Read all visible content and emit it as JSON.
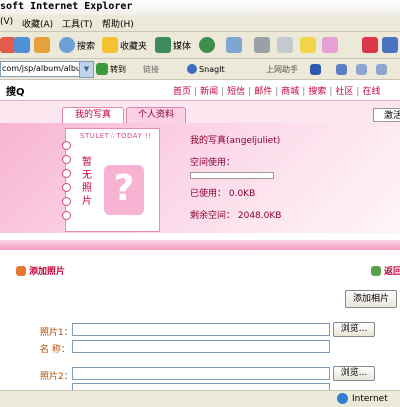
{
  "window": {
    "title": "soft Internet Explorer"
  },
  "menu": [
    "(V)",
    "收藏(A)",
    "工具(T)",
    "帮助(H)"
  ],
  "toolbar": {
    "search": "搜索",
    "favorites": "收藏夹",
    "media": "媒体"
  },
  "address": {
    "url": "com/jsp/album/albu",
    "go": "转到",
    "links": "链接",
    "snagit": "SnagIt",
    "online_helper": "上网助手"
  },
  "site": {
    "logo": "搜Q",
    "nav": [
      "首页",
      "新闻",
      "短信",
      "邮件",
      "商城",
      "搜索",
      "社区",
      "在线"
    ]
  },
  "tabs": {
    "my_photos": "我的写真",
    "personal_info": "个人资料",
    "activate": "激活"
  },
  "album": {
    "notebook_title": "STULET☆TODAY !!",
    "no_photo": "暂无照片",
    "placeholder_glyph": "?",
    "owner": "我的写真(angeljuliet)",
    "space_used_label": "空间使用：",
    "used": "已使用： 0.0KB",
    "remaining": "剩余空间： 2048.0KB",
    "usage_fraction": 0
  },
  "content": {
    "add_photo_link": "添加照片",
    "return_link": "返回",
    "add_photo_button": "添加相片",
    "photo1_label": "照片1：",
    "name_label": "名  称：",
    "photo2_label": "照片2：",
    "browse": "浏览..."
  },
  "status": {
    "zone": "Internet"
  },
  "colors": {
    "accent": "#c4003a",
    "pink": "#f7b4d2"
  }
}
